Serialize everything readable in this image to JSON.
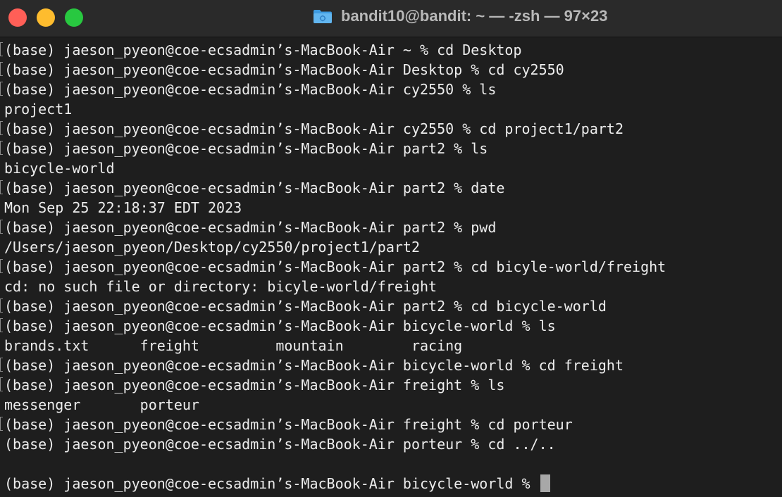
{
  "window": {
    "title": "bandit10@bandit: ~ — -zsh — 97×23",
    "folder_icon": "folder-icon"
  },
  "terminal": {
    "lines": [
      {
        "text": "(base) jaeson_pyeon@coe-ecsadmin’s-MacBook-Air ~ % cd Desktop",
        "mark": true
      },
      {
        "text": "(base) jaeson_pyeon@coe-ecsadmin’s-MacBook-Air Desktop % cd cy2550",
        "mark": true
      },
      {
        "text": "(base) jaeson_pyeon@coe-ecsadmin’s-MacBook-Air cy2550 % ls",
        "mark": true
      },
      {
        "text": "project1",
        "mark": false
      },
      {
        "text": "(base) jaeson_pyeon@coe-ecsadmin’s-MacBook-Air cy2550 % cd project1/part2",
        "mark": true
      },
      {
        "text": "(base) jaeson_pyeon@coe-ecsadmin’s-MacBook-Air part2 % ls",
        "mark": true
      },
      {
        "text": "bicycle-world",
        "mark": false
      },
      {
        "text": "(base) jaeson_pyeon@coe-ecsadmin’s-MacBook-Air part2 % date",
        "mark": true
      },
      {
        "text": "Mon Sep 25 22:18:37 EDT 2023",
        "mark": false
      },
      {
        "text": "(base) jaeson_pyeon@coe-ecsadmin’s-MacBook-Air part2 % pwd",
        "mark": true
      },
      {
        "text": "/Users/jaeson_pyeon/Desktop/cy2550/project1/part2",
        "mark": false
      },
      {
        "text": "(base) jaeson_pyeon@coe-ecsadmin’s-MacBook-Air part2 % cd bicyle-world/freight",
        "mark": true
      },
      {
        "text": "cd: no such file or directory: bicyle-world/freight",
        "mark": false
      },
      {
        "text": "(base) jaeson_pyeon@coe-ecsadmin’s-MacBook-Air part2 % cd bicycle-world",
        "mark": true
      },
      {
        "text": "(base) jaeson_pyeon@coe-ecsadmin’s-MacBook-Air bicycle-world % ls",
        "mark": true
      },
      {
        "text": "brands.txt      freight         mountain        racing",
        "mark": false
      },
      {
        "text": "(base) jaeson_pyeon@coe-ecsadmin’s-MacBook-Air bicycle-world % cd freight",
        "mark": true
      },
      {
        "text": "(base) jaeson_pyeon@coe-ecsadmin’s-MacBook-Air freight % ls",
        "mark": true
      },
      {
        "text": "messenger       porteur",
        "mark": false
      },
      {
        "text": "(base) jaeson_pyeon@coe-ecsadmin’s-MacBook-Air freight % cd porteur",
        "mark": true
      },
      {
        "text": "(base) jaeson_pyeon@coe-ecsadmin’s-MacBook-Air porteur % cd ../..",
        "mark": false
      },
      {
        "text": "",
        "mark": false
      },
      {
        "text": "(base) jaeson_pyeon@coe-ecsadmin’s-MacBook-Air bicycle-world % ",
        "mark": false,
        "cursor": true
      }
    ]
  },
  "colors": {
    "background": "#1e1e1e",
    "titlebar": "#2a2a2a",
    "text": "#ededed",
    "close": "#ff5f57",
    "minimize": "#febc2e",
    "zoom": "#28c840",
    "cursor": "#a8a8a8"
  }
}
